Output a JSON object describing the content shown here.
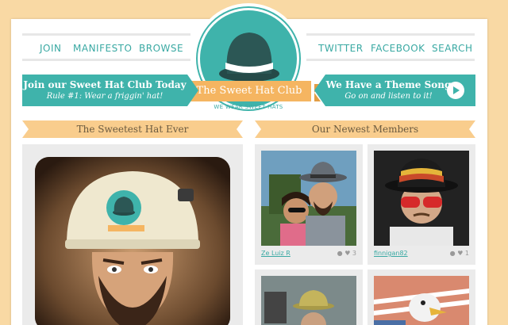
{
  "nav": {
    "left": [
      "JOIN",
      "MANIFESTO",
      "BROWSE"
    ],
    "right": [
      "TWITTER",
      "FACEBOOK",
      "SEARCH"
    ]
  },
  "logo": {
    "title": "The Sweet Hat Club",
    "tagline": "WE WEAR SWEET HATS"
  },
  "banner_left": {
    "title": "Join our Sweet Hat Club Today",
    "subtitle": "Rule #1: Wear a friggin' hat!"
  },
  "banner_right": {
    "title": "We Have a Theme Song",
    "subtitle": "Go on and listen to it!"
  },
  "sections": {
    "featured": "The Sweetest Hat Ever",
    "newest": "Our Newest Members"
  },
  "members": [
    {
      "name": "Ze Luiz R",
      "comments": "",
      "likes": "3"
    },
    {
      "name": "finnigan82",
      "comments": "",
      "likes": "1"
    }
  ],
  "colors": {
    "teal": "#3fb3ab",
    "orange": "#f5b561",
    "peach": "#f9d9a4"
  }
}
